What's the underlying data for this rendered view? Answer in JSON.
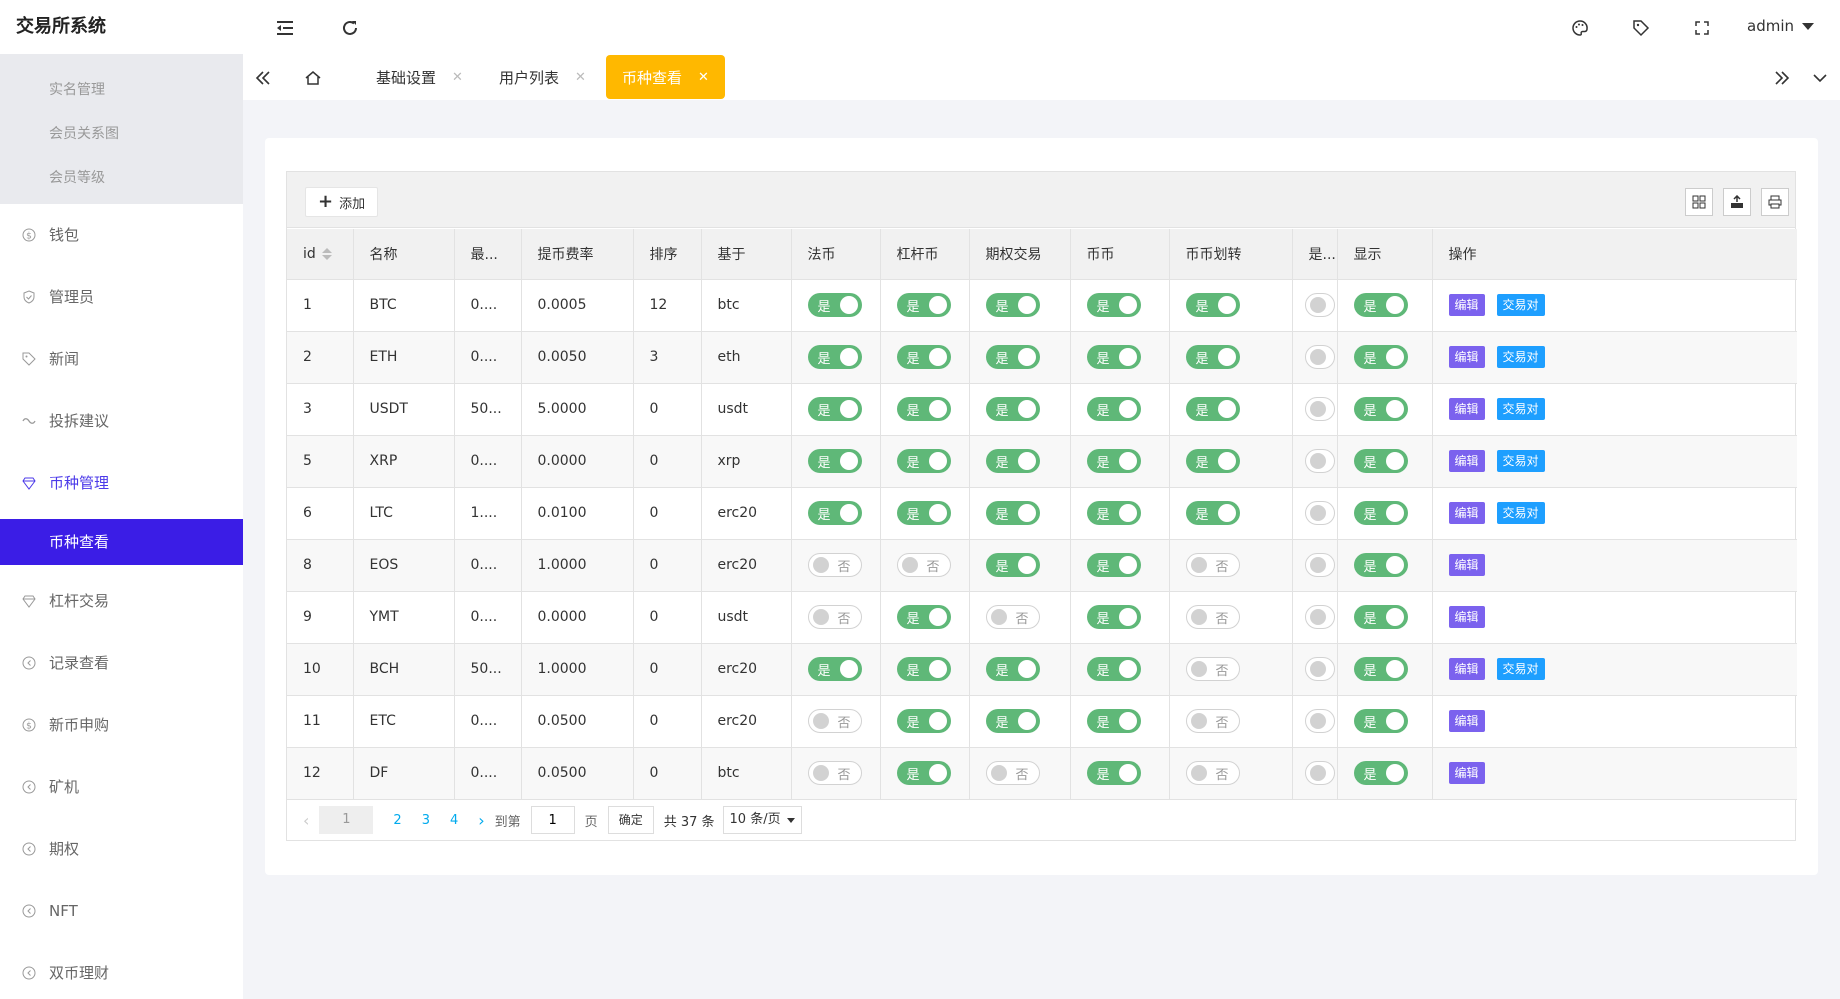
{
  "app_title": "交易所系统",
  "sidebar": {
    "sub_items_top": [
      "实名管理",
      "会员关系图",
      "会员等级"
    ],
    "items": [
      {
        "label": "钱包",
        "icon": "dollar-icon"
      },
      {
        "label": "管理员",
        "icon": "shield-icon"
      },
      {
        "label": "新闻",
        "icon": "tag-icon"
      },
      {
        "label": "投拆建议",
        "icon": "link-icon"
      },
      {
        "label": "币种管理",
        "icon": "diamond-icon",
        "active": true
      },
      {
        "label": "杠杆交易",
        "icon": "diamond-icon"
      },
      {
        "label": "记录查看",
        "icon": "circle-arrow-icon"
      },
      {
        "label": "新币申购",
        "icon": "dollar-icon"
      },
      {
        "label": "矿机",
        "icon": "circle-arrow-icon"
      },
      {
        "label": "期权",
        "icon": "circle-arrow-icon"
      },
      {
        "label": "NFT",
        "icon": "circle-arrow-icon"
      },
      {
        "label": "双币理财",
        "icon": "circle-arrow-icon"
      }
    ],
    "active_sub": "币种查看"
  },
  "header": {
    "user": "admin"
  },
  "tabs": [
    {
      "label": "基础设置"
    },
    {
      "label": "用户列表"
    },
    {
      "label": "币种查看",
      "active": true
    }
  ],
  "toolbar": {
    "add_label": "添加"
  },
  "table": {
    "columns": [
      "id",
      "名称",
      "最...",
      "提币费率",
      "排序",
      "基于",
      "法币",
      "杠杆币",
      "期权交易",
      "币币",
      "币币划转",
      "是...",
      "显示",
      "操作"
    ],
    "switch_on": "是",
    "switch_off": "否",
    "edit_label": "编辑",
    "pair_label": "交易对",
    "rows": [
      {
        "id": "1",
        "name": "BTC",
        "min": "0....",
        "fee": "0.0005",
        "sort": "12",
        "base": "btc",
        "fiat": true,
        "lever": true,
        "option": true,
        "coin": true,
        "transfer": true,
        "show": true,
        "pair": true
      },
      {
        "id": "2",
        "name": "ETH",
        "min": "0....",
        "fee": "0.0050",
        "sort": "3",
        "base": "eth",
        "fiat": true,
        "lever": true,
        "option": true,
        "coin": true,
        "transfer": true,
        "show": true,
        "pair": true
      },
      {
        "id": "3",
        "name": "USDT",
        "min": "50...",
        "fee": "5.0000",
        "sort": "0",
        "base": "usdt",
        "fiat": true,
        "lever": true,
        "option": true,
        "coin": true,
        "transfer": true,
        "show": true,
        "pair": true
      },
      {
        "id": "5",
        "name": "XRP",
        "min": "0....",
        "fee": "0.0000",
        "sort": "0",
        "base": "xrp",
        "fiat": true,
        "lever": true,
        "option": true,
        "coin": true,
        "transfer": true,
        "show": true,
        "pair": true
      },
      {
        "id": "6",
        "name": "LTC",
        "min": "1....",
        "fee": "0.0100",
        "sort": "0",
        "base": "erc20",
        "fiat": true,
        "lever": true,
        "option": true,
        "coin": true,
        "transfer": true,
        "show": true,
        "pair": true
      },
      {
        "id": "8",
        "name": "EOS",
        "min": "0....",
        "fee": "1.0000",
        "sort": "0",
        "base": "erc20",
        "fiat": false,
        "lever": false,
        "option": true,
        "coin": true,
        "transfer": false,
        "show": true,
        "pair": false
      },
      {
        "id": "9",
        "name": "YMT",
        "min": "0....",
        "fee": "0.0000",
        "sort": "0",
        "base": "usdt",
        "fiat": false,
        "lever": true,
        "option": false,
        "coin": true,
        "transfer": false,
        "show": true,
        "pair": false
      },
      {
        "id": "10",
        "name": "BCH",
        "min": "50...",
        "fee": "1.0000",
        "sort": "0",
        "base": "erc20",
        "fiat": true,
        "lever": true,
        "option": true,
        "coin": true,
        "transfer": false,
        "show": true,
        "pair": true
      },
      {
        "id": "11",
        "name": "ETC",
        "min": "0....",
        "fee": "0.0500",
        "sort": "0",
        "base": "erc20",
        "fiat": false,
        "lever": true,
        "option": true,
        "coin": true,
        "transfer": false,
        "show": true,
        "pair": false
      },
      {
        "id": "12",
        "name": "DF",
        "min": "0....",
        "fee": "0.0500",
        "sort": "0",
        "base": "btc",
        "fiat": false,
        "lever": true,
        "option": false,
        "coin": true,
        "transfer": false,
        "show": true,
        "pair": false
      }
    ]
  },
  "pager": {
    "current": "1",
    "pages": [
      "2",
      "3",
      "4"
    ],
    "goto_label": "到第",
    "goto_value": "1",
    "page_unit": "页",
    "confirm": "确定",
    "total": "共 37 条",
    "per_page": "10 条/页"
  },
  "colors": {
    "accent": "#3b1de6",
    "tab_active": "#ffb800",
    "switch_on": "#5fb878",
    "edit": "#7b62ee",
    "pair": "#1e9fff"
  }
}
